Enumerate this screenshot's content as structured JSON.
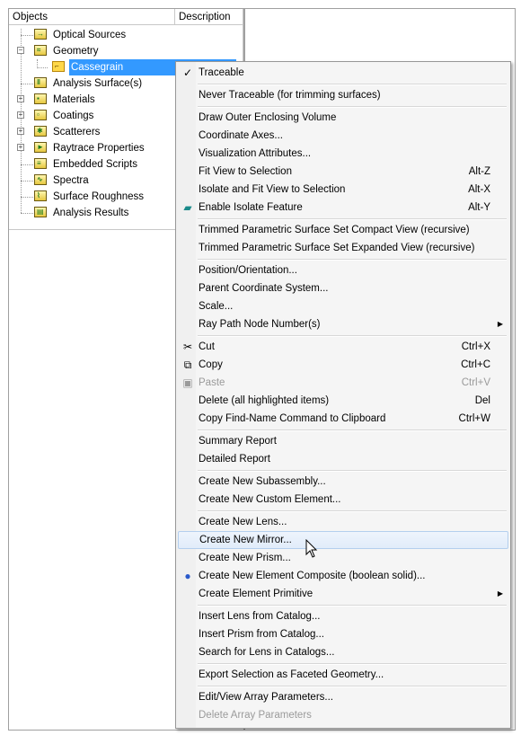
{
  "tree": {
    "header_objects": "Objects",
    "header_description": "Description",
    "items": [
      {
        "label": "Optical Sources",
        "icon": "optical-sources-icon"
      },
      {
        "label": "Geometry",
        "icon": "geometry-icon"
      },
      {
        "label": "Cassegrain",
        "icon": "cassegrain-icon",
        "selected": true
      },
      {
        "label": "Analysis Surface(s)",
        "icon": "analysis-surfaces-icon"
      },
      {
        "label": "Materials",
        "icon": "materials-icon"
      },
      {
        "label": "Coatings",
        "icon": "coatings-icon"
      },
      {
        "label": "Scatterers",
        "icon": "scatterers-icon"
      },
      {
        "label": "Raytrace Properties",
        "icon": "raytrace-properties-icon"
      },
      {
        "label": "Embedded Scripts",
        "icon": "embedded-scripts-icon"
      },
      {
        "label": "Spectra",
        "icon": "spectra-icon"
      },
      {
        "label": "Surface Roughness",
        "icon": "surface-roughness-icon"
      },
      {
        "label": "Analysis Results",
        "icon": "analysis-results-icon"
      }
    ]
  },
  "menu": {
    "traceable": "Traceable",
    "never_traceable": "Never Traceable (for trimming surfaces)",
    "draw_outer": "Draw Outer Enclosing Volume",
    "coord_axes": "Coordinate Axes...",
    "visualization": "Visualization Attributes...",
    "fit_view": "Fit View to Selection",
    "fit_view_sc": "Alt-Z",
    "isolate_fit": "Isolate and Fit View to Selection",
    "isolate_fit_sc": "Alt-X",
    "enable_isolate": "Enable Isolate Feature",
    "enable_isolate_sc": "Alt-Y",
    "trimmed_compact": "Trimmed Parametric Surface Set Compact View (recursive)",
    "trimmed_expanded": "Trimmed Parametric Surface Set Expanded View (recursive)",
    "position": "Position/Orientation...",
    "parent_coord": "Parent Coordinate System...",
    "scale": "Scale...",
    "ray_path": "Ray Path Node Number(s)",
    "cut": "Cut",
    "cut_sc": "Ctrl+X",
    "copy": "Copy",
    "copy_sc": "Ctrl+C",
    "paste": "Paste",
    "paste_sc": "Ctrl+V",
    "delete": "Delete (all highlighted items)",
    "delete_sc": "Del",
    "copy_find": "Copy Find-Name Command to Clipboard",
    "copy_find_sc": "Ctrl+W",
    "summary": "Summary Report",
    "detailed": "Detailed Report",
    "new_subassembly": "Create New Subassembly...",
    "new_custom": "Create New Custom Element...",
    "new_lens": "Create New Lens...",
    "new_mirror": "Create New Mirror...",
    "new_prism": "Create New Prism...",
    "new_composite": "Create New Element Composite (boolean solid)...",
    "element_primitive": "Create Element Primitive",
    "insert_lens": "Insert Lens from Catalog...",
    "insert_prism": "Insert Prism from Catalog...",
    "search_lens": "Search for Lens in Catalogs...",
    "export_faceted": "Export Selection as Faceted Geometry...",
    "edit_array": "Edit/View Array Parameters...",
    "delete_array": "Delete Array Parameters"
  }
}
